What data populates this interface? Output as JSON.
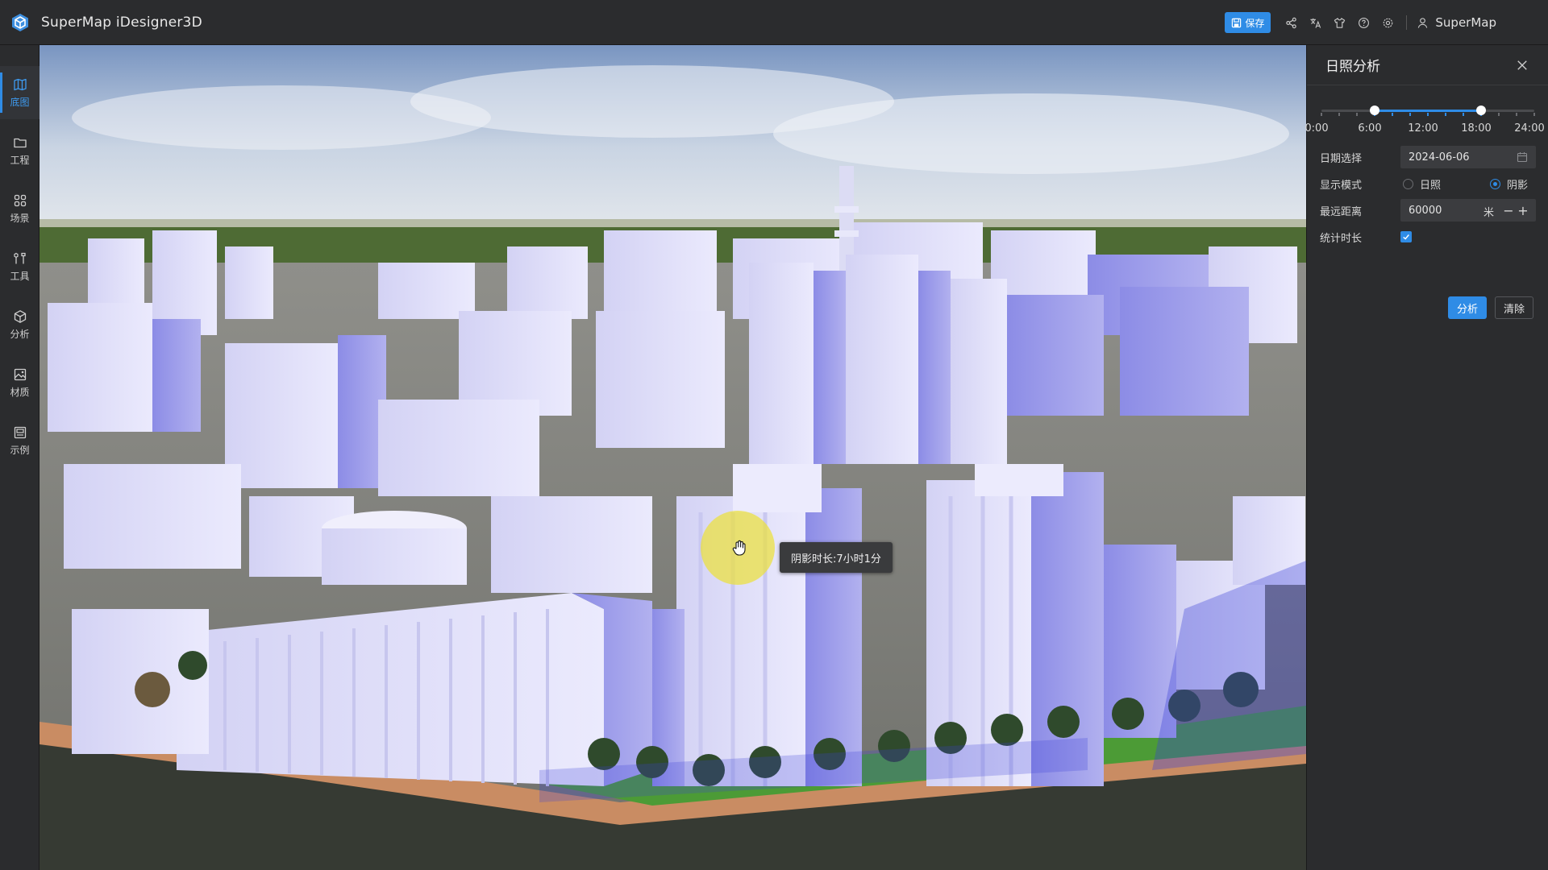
{
  "app": {
    "title": "SuperMap iDesigner3D"
  },
  "toolbar": {
    "save_label": "保存",
    "icons": [
      "share-icon",
      "translate-icon",
      "shirt-icon",
      "help-icon",
      "settings-icon"
    ],
    "user_name": "SuperMap"
  },
  "sidebar": {
    "items": [
      {
        "label": "底图",
        "icon": "map-icon",
        "active": true
      },
      {
        "label": "工程",
        "icon": "folder-icon",
        "active": false
      },
      {
        "label": "场景",
        "icon": "grid-icon",
        "active": false
      },
      {
        "label": "工具",
        "icon": "tools-icon",
        "active": false
      },
      {
        "label": "分析",
        "icon": "cube-icon",
        "active": false
      },
      {
        "label": "材质",
        "icon": "image-icon",
        "active": false
      },
      {
        "label": "示例",
        "icon": "example-icon",
        "active": false
      }
    ]
  },
  "viewport": {
    "tooltip": "阴影时长:7小时1分"
  },
  "panel": {
    "title": "日照分析",
    "time_range": {
      "min": 0,
      "max": 24,
      "start": 6,
      "end": 18
    },
    "time_labels": [
      "0:00",
      "6:00",
      "12:00",
      "18:00",
      "24:00"
    ],
    "date": {
      "label": "日期选择",
      "value": "2024-06-06"
    },
    "display_mode": {
      "label": "显示模式",
      "options": [
        "日照",
        "阴影"
      ],
      "selected": "阴影"
    },
    "max_distance": {
      "label": "最远距离",
      "value": "60000",
      "unit": "米"
    },
    "statistics": {
      "label": "统计时长",
      "checked": true
    },
    "analyze_label": "分析",
    "clear_label": "清除"
  },
  "colors": {
    "accent": "#2f8ce6",
    "panel_bg": "#2b2c2e",
    "building": "#dcdcf6"
  }
}
